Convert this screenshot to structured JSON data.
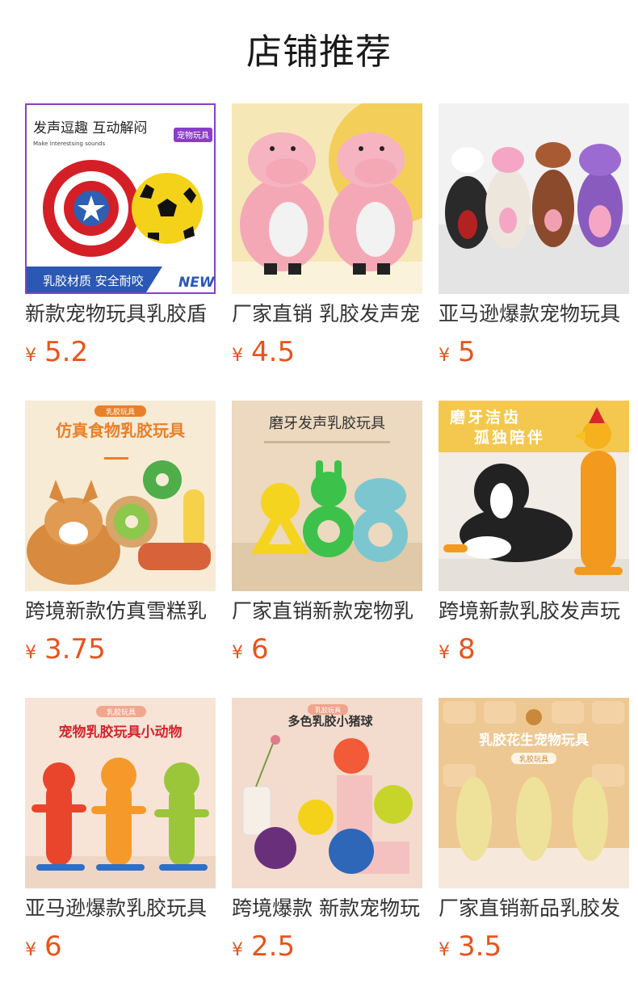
{
  "page_title": "店铺推荐",
  "currency_symbol": "¥",
  "products": [
    {
      "name": "新款宠物玩具乳胶盾",
      "price": "5.2",
      "img_text": {
        "headline": "发声逗趣 互动解闷",
        "sub": "Make interestsing sounds",
        "tag": "宠物玩具",
        "footer": "乳胶材质 安全耐咬",
        "badge": "NEW"
      }
    },
    {
      "name": "厂家直销 乳胶发声宠",
      "price": "4.5"
    },
    {
      "name": "亚马逊爆款宠物玩具",
      "price": "5"
    },
    {
      "name": "跨境新款仿真雪糕乳",
      "price": "3.75",
      "img_text": {
        "tag": "乳胶玩具",
        "headline": "仿真食物乳胶玩具"
      }
    },
    {
      "name": "厂家直销新款宠物乳",
      "price": "6",
      "img_text": {
        "headline": "磨牙发声乳胶玩具"
      }
    },
    {
      "name": "跨境新款乳胶发声玩",
      "price": "8",
      "img_text": {
        "line1": "磨牙洁齿",
        "line2": "孤独陪伴"
      }
    },
    {
      "name": "亚马逊爆款乳胶玩具",
      "price": "6",
      "img_text": {
        "tag": "乳胶玩具",
        "headline": "宠物乳胶玩具小动物"
      }
    },
    {
      "name": "跨境爆款 新款宠物玩",
      "price": "2.5",
      "img_text": {
        "tag": "乳胶玩具",
        "headline": "多色乳胶小猪球"
      }
    },
    {
      "name": "厂家直销新品乳胶发",
      "price": "3.5",
      "img_text": {
        "headline": "乳胶花生宠物玩具",
        "tag": "乳胶玩具"
      }
    }
  ]
}
